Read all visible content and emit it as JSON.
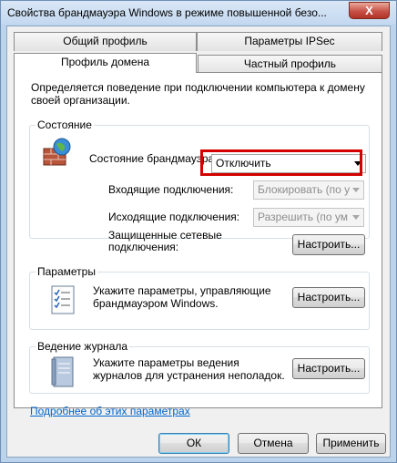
{
  "window": {
    "title": "Свойства брандмауэра Windows в режиме повышенной безо...",
    "close_symbol": "X"
  },
  "tabs": {
    "row_back": [
      "Общий профиль",
      "Параметры IPSec"
    ],
    "row_front": [
      "Профиль домена",
      "Частный профиль"
    ],
    "active": "Профиль домена"
  },
  "panel": {
    "description": "Определяется поведение при подключении компьютера к домену своей организации."
  },
  "state_group": {
    "title": "Состояние",
    "firewall_state_label": "Состояние брандмауэра:",
    "firewall_state_value": "Отключить",
    "inbound_label": "Входящие подключения:",
    "inbound_value": "Блокировать (по у",
    "outbound_label": "Исходящие подключения:",
    "outbound_value": "Разрешить (по ум",
    "protected_label": "Защищенные сетевые подключения:",
    "configure_button": "Настроить..."
  },
  "settings_group": {
    "title": "Параметры",
    "text": "Укажите параметры, управляющие брандмауэром Windows.",
    "configure_button": "Настроить..."
  },
  "logging_group": {
    "title": "Ведение журнала",
    "text": "Укажите параметры ведения журналов для устранения неполадок.",
    "configure_button": "Настроить..."
  },
  "footer": {
    "link": "Подробнее об этих параметрах",
    "ok": "ОК",
    "cancel": "Отмена",
    "apply": "Применить"
  }
}
